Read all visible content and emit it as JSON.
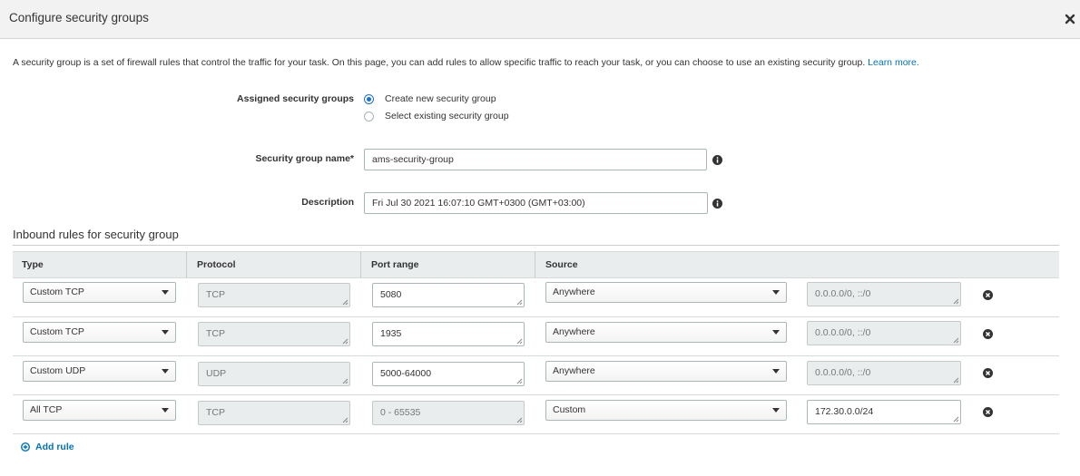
{
  "modal": {
    "title": "Configure security groups"
  },
  "intro": {
    "text": "A security group is a set of firewall rules that control the traffic for your task. On this page, you can add rules to allow specific traffic to reach your task, or you can choose to use an existing security group.",
    "link": "Learn more."
  },
  "assigned": {
    "label": "Assigned security groups",
    "options": [
      {
        "label": "Create new security group",
        "selected": true
      },
      {
        "label": "Select existing security group",
        "selected": false
      }
    ]
  },
  "group_name": {
    "label": "Security group name*",
    "value": "ams-security-group"
  },
  "description": {
    "label": "Description",
    "value": "Fri Jul 30 2021 16:07:10 GMT+0300 (GMT+03:00)"
  },
  "inbound": {
    "title": "Inbound rules for security group",
    "columns": [
      "Type",
      "Protocol",
      "Port range",
      "Source"
    ],
    "rules": [
      {
        "type": "Custom TCP",
        "protocol": "TCP",
        "port_range": "5080",
        "port_editable": true,
        "source": "Anywhere",
        "cidr": "0.0.0.0/0, ::/0",
        "cidr_editable": false
      },
      {
        "type": "Custom TCP",
        "protocol": "TCP",
        "port_range": "1935",
        "port_editable": true,
        "source": "Anywhere",
        "cidr": "0.0.0.0/0, ::/0",
        "cidr_editable": false
      },
      {
        "type": "Custom UDP",
        "protocol": "UDP",
        "port_range": "5000-64000",
        "port_editable": true,
        "source": "Anywhere",
        "cidr": "0.0.0.0/0, ::/0",
        "cidr_editable": false
      },
      {
        "type": "All TCP",
        "protocol": "TCP",
        "port_range": "0 - 65535",
        "port_editable": false,
        "source": "Custom",
        "cidr": "172.30.0.0/24",
        "cidr_editable": true
      }
    ],
    "add_rule_label": "Add rule"
  },
  "icons": {
    "close": "close-icon",
    "info": "info-icon",
    "remove": "remove-icon",
    "add": "plus-circle-icon",
    "dropdown": "caret-down-icon"
  },
  "colors": {
    "link": "#0073bb",
    "radio_selected": "#1b70c9",
    "header_bg": "#f2f2f2",
    "table_header_bg": "#eaeded",
    "disabled_bg": "#eaeded"
  }
}
